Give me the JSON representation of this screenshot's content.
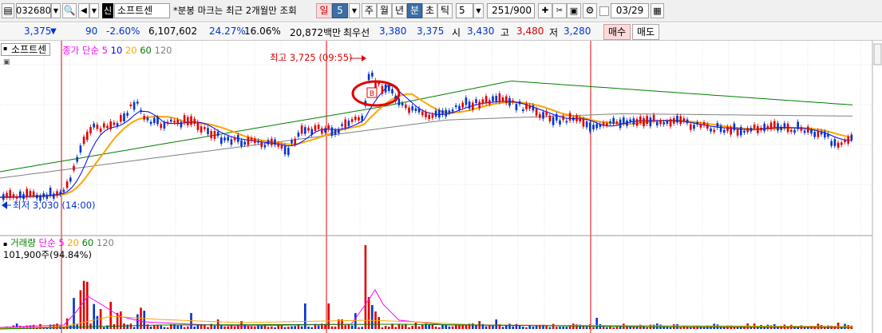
{
  "toolbar": {
    "code": "032680",
    "market_badge": "신",
    "stock_name": "소프트센",
    "notice": "*분봉 마크는 최근 2개월만 조회",
    "periods": [
      "일",
      "5",
      "주",
      "월",
      "년",
      "분",
      "초",
      "틱"
    ],
    "interval": "5",
    "count": "251/900",
    "date": "03/29"
  },
  "quote": {
    "price": "3,375",
    "change": "90",
    "rate": "-2.60%",
    "volume": "6,107,602",
    "turnover": "24.27%",
    "extra": "16.06%",
    "amount": "20,872백만",
    "best_label": "최우선",
    "best_ask": "3,380",
    "best_bid": "3,375",
    "open_label": "시",
    "open": "3,430",
    "high_label": "고",
    "high": "3,480",
    "low_label": "저",
    "low": "3,280",
    "buy": "매수",
    "sell": "매도"
  },
  "price_panel": {
    "title": "소프트센",
    "legend": [
      "종가 단순",
      "5",
      "10",
      "20",
      "60",
      "120"
    ],
    "legend_colors": [
      "#ff00ff",
      "#0000ff",
      "#0000ff",
      "#ffa500",
      "#008000",
      "#808080"
    ],
    "high_note": "최고 3,725 (09:55)",
    "low_note": "최저 3,030 (14:00)",
    "marker": "B"
  },
  "volume_panel": {
    "legend": [
      "거래량",
      "단순",
      "5",
      "20",
      "60",
      "120"
    ],
    "legend_colors": [
      "#008000",
      "#ff00ff",
      "#ff00ff",
      "#ffa500",
      "#008000",
      "#808080"
    ],
    "value": "101,900주(94.84%)"
  }
}
